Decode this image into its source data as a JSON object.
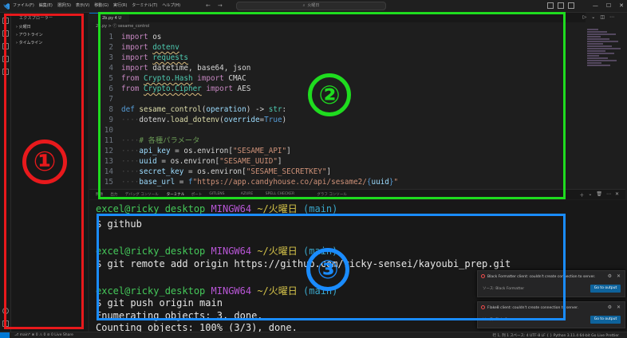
{
  "titlebar": {
    "menu": [
      "ファイル(F)",
      "編集(E)",
      "選択(S)",
      "表示(V)",
      "移動(G)",
      "実行(R)",
      "ターミナル(T)",
      "ヘルプ(H)"
    ],
    "nav_back": "←",
    "nav_forward": "→",
    "search_label": "火曜日",
    "minimize": "—",
    "maximize": "☐",
    "close": "✕"
  },
  "sidebar": {
    "title": "エクスプローラー",
    "items": [
      "› 火曜日",
      "› アウトライン",
      "› タイムライン"
    ]
  },
  "editor": {
    "tab_label": "2b.py 4 U",
    "breadcrumb": "2b.py > ⓕ sesame_control",
    "actions": [
      "▷",
      "⌄",
      "◫",
      "⋯"
    ]
  },
  "code_lines": [
    {
      "n": "1",
      "parts": [
        [
          "kw",
          "import"
        ],
        [
          "plain",
          " os"
        ]
      ]
    },
    {
      "n": "2",
      "parts": [
        [
          "kw",
          "import"
        ],
        [
          "plain",
          " "
        ],
        [
          "mod sq",
          "dotenv"
        ]
      ]
    },
    {
      "n": "3",
      "parts": [
        [
          "kw",
          "import"
        ],
        [
          "plain",
          " "
        ],
        [
          "mod sq",
          "requests"
        ]
      ]
    },
    {
      "n": "4",
      "parts": [
        [
          "kw",
          "import"
        ],
        [
          "plain",
          " datetime, base64, json"
        ]
      ]
    },
    {
      "n": "5",
      "parts": [
        [
          "kw",
          "from"
        ],
        [
          "plain",
          " "
        ],
        [
          "mod sq",
          "Crypto.Hash"
        ],
        [
          "kw",
          " import"
        ],
        [
          "plain",
          " CMAC"
        ]
      ]
    },
    {
      "n": "6",
      "parts": [
        [
          "kw",
          "from"
        ],
        [
          "plain",
          " "
        ],
        [
          "mod sq",
          "Crypto.Cipher"
        ],
        [
          "kw",
          " import"
        ],
        [
          "plain",
          " AES"
        ]
      ]
    },
    {
      "n": "7",
      "parts": []
    },
    {
      "n": "8",
      "parts": [
        [
          "def",
          "def"
        ],
        [
          "fn",
          " sesame_control"
        ],
        [
          "plain",
          "("
        ],
        [
          "var",
          "operation"
        ],
        [
          "plain",
          ") -> "
        ],
        [
          "mod",
          "str"
        ],
        [
          "plain",
          ":"
        ]
      ]
    },
    {
      "n": "9",
      "parts": [
        [
          "ws",
          "····"
        ],
        [
          "plain",
          "dotenv."
        ],
        [
          "fn",
          "load_dotenv"
        ],
        [
          "plain",
          "("
        ],
        [
          "var",
          "override"
        ],
        [
          "plain",
          "="
        ],
        [
          "def",
          "True"
        ],
        [
          "plain",
          ")"
        ]
      ]
    },
    {
      "n": "10",
      "parts": []
    },
    {
      "n": "11",
      "parts": [
        [
          "ws",
          "····"
        ],
        [
          "cmt",
          "# 各種パラメータ"
        ]
      ]
    },
    {
      "n": "12",
      "parts": [
        [
          "ws",
          "····"
        ],
        [
          "var",
          "api_key"
        ],
        [
          "plain",
          " = os.environ["
        ],
        [
          "str",
          "\"SESAME_API\""
        ],
        [
          "plain",
          "]"
        ]
      ]
    },
    {
      "n": "13",
      "parts": [
        [
          "ws",
          "····"
        ],
        [
          "var",
          "uuid"
        ],
        [
          "plain",
          " = os.environ["
        ],
        [
          "str",
          "\"SESAME_UUID\""
        ],
        [
          "plain",
          "]"
        ]
      ]
    },
    {
      "n": "14",
      "parts": [
        [
          "ws",
          "····"
        ],
        [
          "var",
          "secret_key"
        ],
        [
          "plain",
          " = os.environ["
        ],
        [
          "str",
          "\"SESAME_SECRETKEY\""
        ],
        [
          "plain",
          "]"
        ]
      ]
    },
    {
      "n": "15",
      "parts": [
        [
          "ws",
          "····"
        ],
        [
          "var",
          "base_url"
        ],
        [
          "plain",
          " = "
        ],
        [
          "def",
          "f"
        ],
        [
          "str",
          "\"https://app.candyhouse.co/api/sesame2/"
        ],
        [
          "def",
          "{"
        ],
        [
          "var",
          "uuid"
        ],
        [
          "def",
          "}"
        ],
        [
          "str",
          "\""
        ]
      ]
    }
  ],
  "panel_tabs": [
    "問題",
    "出力",
    "デバッグ コンソール",
    "ターミナル",
    "ポート",
    "GITLENS",
    "AZURE",
    "SPELL CHECKER",
    "グラフ コンソール"
  ],
  "panel_active": 3,
  "terminal_lines": [
    {
      "type": "prompt",
      "user": "excel@ricky_desktop",
      "host": "MINGW64",
      "path": "~/火曜日",
      "branch": "(main)"
    },
    {
      "type": "cmd",
      "text": "$ github"
    },
    {
      "type": "blank",
      "text": ""
    },
    {
      "type": "prompt",
      "user": "excel@ricky_desktop",
      "host": "MINGW64",
      "path": "~/火曜日",
      "branch": "(main)"
    },
    {
      "type": "cmd",
      "text": "$ git remote add origin https://github.com/ricky-sensei/kayoubi_prep.git"
    },
    {
      "type": "blank",
      "text": ""
    },
    {
      "type": "prompt",
      "user": "excel@ricky_desktop",
      "host": "MINGW64",
      "path": "~/火曜日",
      "branch": "(main)"
    },
    {
      "type": "cmd",
      "text": "$ git push origin main"
    },
    {
      "type": "cmd",
      "text": "Enumerating objects: 3, done."
    },
    {
      "type": "cmd",
      "text": "Counting objects: 100% (3/3), done."
    }
  ],
  "notifications": [
    {
      "message": "Black Formatter client: couldn't create connection to server.",
      "source": "ソース: Black Formatter",
      "button": "Go to output"
    },
    {
      "message": "Flake8 client: couldn't create connection to server.",
      "source": "ソース: Flake8",
      "button": "Go to output"
    }
  ],
  "statusbar": {
    "left": "⎇ main*   ⊗ 0 ⚠ 0   ⊘ 0   Live Share",
    "right": "行 1, 列 1   スペース: 4   UTF-8   LF   { } Python   3.11.4 64-bit   Go Live   Prettier"
  },
  "annotations": {
    "colors": {
      "red": "#e8191c",
      "green": "#1fdc1f",
      "blue": "#1a8cff"
    },
    "labels": [
      "①",
      "②",
      "③"
    ]
  }
}
